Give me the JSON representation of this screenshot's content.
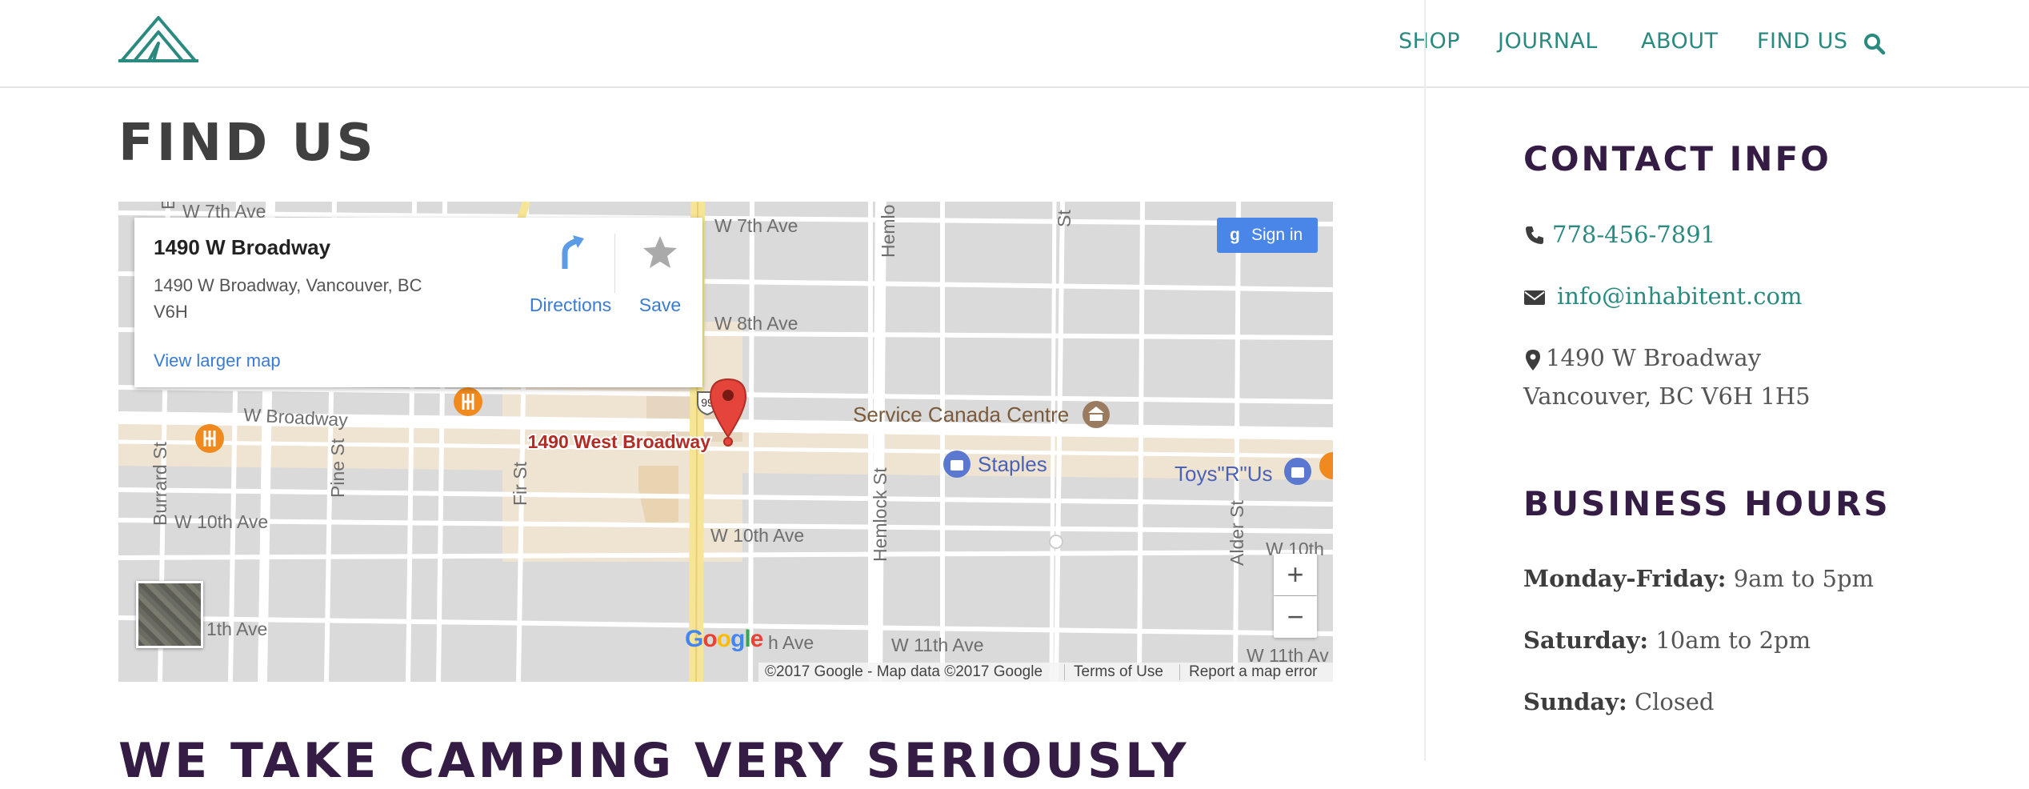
{
  "nav": {
    "items": [
      {
        "label": "SHOP"
      },
      {
        "label": "JOURNAL"
      },
      {
        "label": "ABOUT"
      },
      {
        "label": "FIND US"
      }
    ],
    "search_icon": "search-icon",
    "color": "#2a8a80"
  },
  "page": {
    "title": "FIND US",
    "bottom_heading": "WE TAKE CAMPING VERY SERIOUSLY"
  },
  "map": {
    "card": {
      "title": "1490 W Broadway",
      "address": "1490 W Broadway, Vancouver, BC V6H",
      "larger_map_link": "View larger map",
      "directions_label": "Directions",
      "save_label": "Save"
    },
    "signin_label": "Sign in",
    "signin_g": "g",
    "zoom_in": "+",
    "zoom_out": "−",
    "google_logo": "Google",
    "footer": {
      "copyright": "©2017 Google - Map data ©2017 Google",
      "terms": "Terms of Use",
      "report": "Report a map error"
    },
    "labels": {
      "w7th_left": "W 7th Ave",
      "w7th_right": "W 7th Ave",
      "w8th": "W 8th Ave",
      "w_broadway": "W Broadway",
      "service_canada": "Service Canada Centre",
      "staples": "Staples",
      "toys": "Toys\"R\"Us",
      "pin_label": "1490 West Broadway",
      "hwy": "99",
      "w10th_left": "W 10th Ave",
      "w10th_mid": "W 10th Ave",
      "w10th_right": "W 10th",
      "w11th_left": "1th Ave",
      "w11th_mid": "h Ave",
      "w11th_mid2": "W 11th Ave",
      "w11th_right": "W 11th Av",
      "burrard": "Burrard St",
      "pine": "Pine St",
      "fir": "Fir St",
      "hemlock": "Hemlock St",
      "hemlock_top": "Hemlo",
      "alder": "Alder St",
      "st_top": "St",
      "e_top": "E"
    }
  },
  "contact": {
    "heading": "CONTACT INFO",
    "phone": "778-456-7891",
    "email": "info@inhabitent.com",
    "address_line1": "1490 W Broadway",
    "address_line2": "Vancouver, BC V6H 1H5"
  },
  "hours": {
    "heading": "BUSINESS HOURS",
    "rows": [
      {
        "day": "Monday-Friday:",
        "time": "9am to 5pm"
      },
      {
        "day": "Saturday:",
        "time": "10am to 2pm"
      },
      {
        "day": "Sunday:",
        "time": "Closed"
      }
    ]
  },
  "colors": {
    "accent": "#2a8a80",
    "heading": "#351c45",
    "map_link": "#3a7bd5",
    "pin": "#e5443a"
  }
}
